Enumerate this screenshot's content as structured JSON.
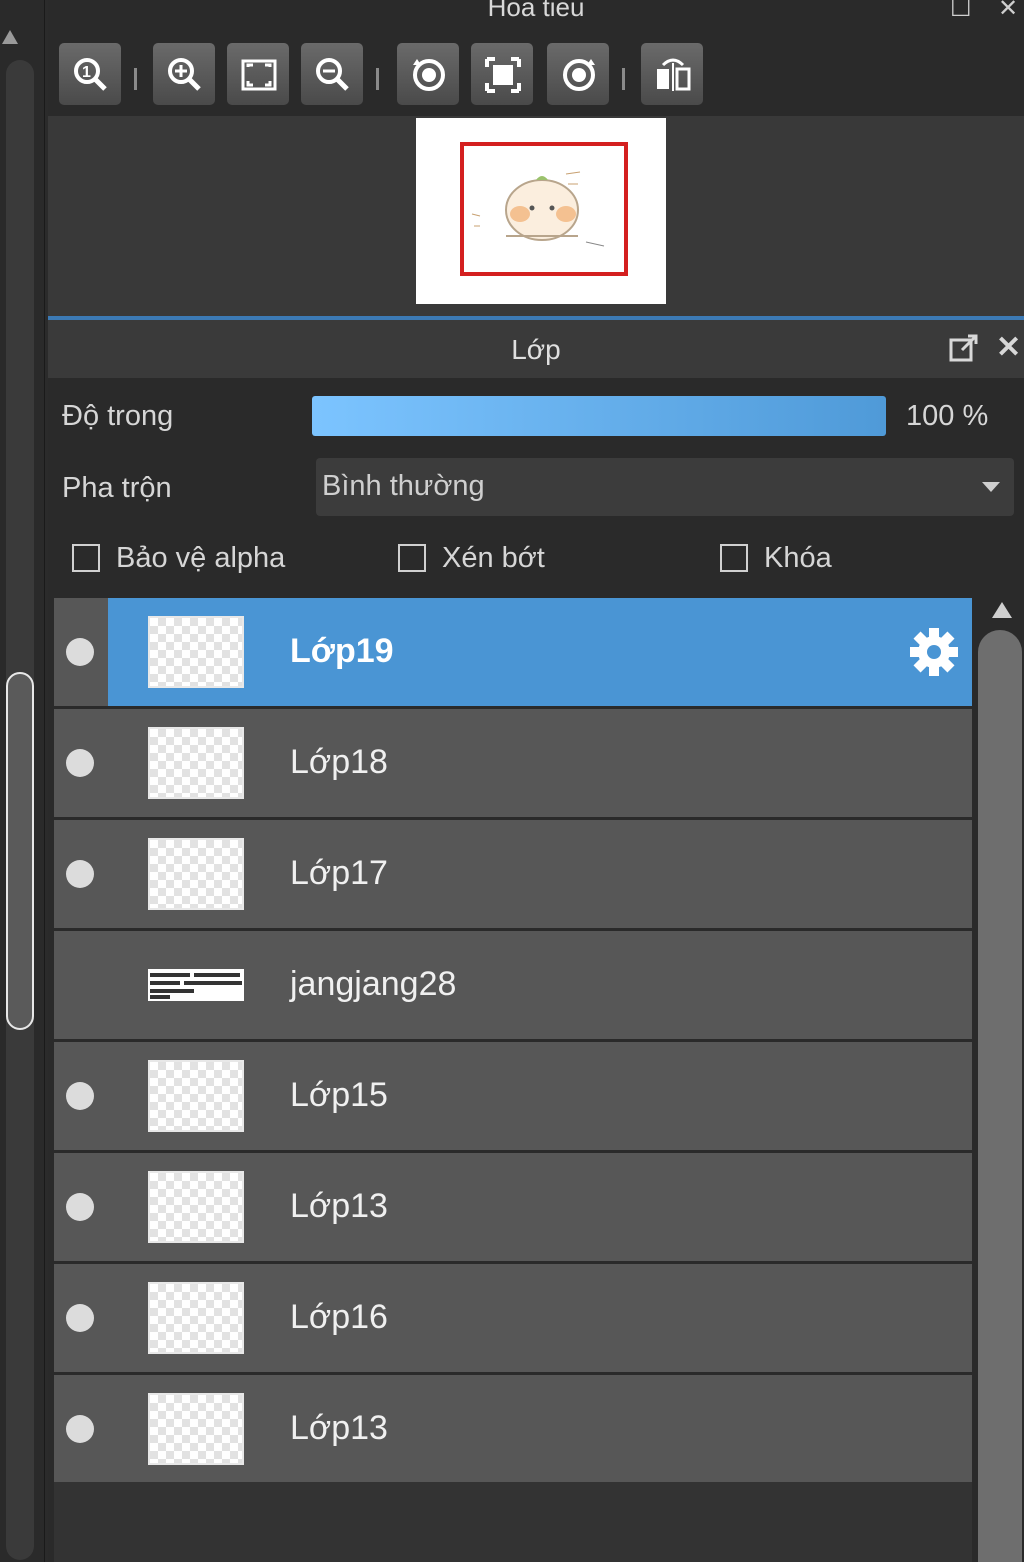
{
  "navigator": {
    "title": "Hoa tieu",
    "toolbar": [
      {
        "name": "zoom-actual-icon"
      },
      {
        "name": "zoom-in-icon"
      },
      {
        "name": "fit-window-icon"
      },
      {
        "name": "zoom-out-icon"
      },
      {
        "name": "rotate-left-icon"
      },
      {
        "name": "fit-canvas-icon"
      },
      {
        "name": "rotate-right-icon"
      },
      {
        "name": "flip-horizontal-icon"
      }
    ]
  },
  "layers_panel": {
    "title": "Lớp",
    "opacity_label": "Độ trong",
    "opacity_value": "100 %",
    "opacity_fraction": 1.0,
    "blend_label": "Pha trộn",
    "blend_value": "Bình thường",
    "checkboxes": {
      "protect_alpha": "Bảo vệ alpha",
      "clipping": "Xén bớt",
      "lock": "Khóa"
    },
    "layers": [
      {
        "name": "Lớp19",
        "selected": true,
        "visible": true,
        "type": "raster"
      },
      {
        "name": "Lớp18",
        "selected": false,
        "visible": true,
        "type": "raster"
      },
      {
        "name": "Lớp17",
        "selected": false,
        "visible": true,
        "type": "raster"
      },
      {
        "name": "jangjang28",
        "selected": false,
        "visible": false,
        "type": "text"
      },
      {
        "name": "Lớp15",
        "selected": false,
        "visible": true,
        "type": "raster"
      },
      {
        "name": "Lớp13",
        "selected": false,
        "visible": true,
        "type": "raster"
      },
      {
        "name": "Lớp16",
        "selected": false,
        "visible": true,
        "type": "raster"
      },
      {
        "name": "Lớp13",
        "selected": false,
        "visible": true,
        "type": "raster"
      }
    ]
  },
  "colors": {
    "selection": "#4a95d4",
    "panel_bg": "#2a2a2a",
    "row_bg": "#575757",
    "viewport_rect": "#d42020"
  }
}
